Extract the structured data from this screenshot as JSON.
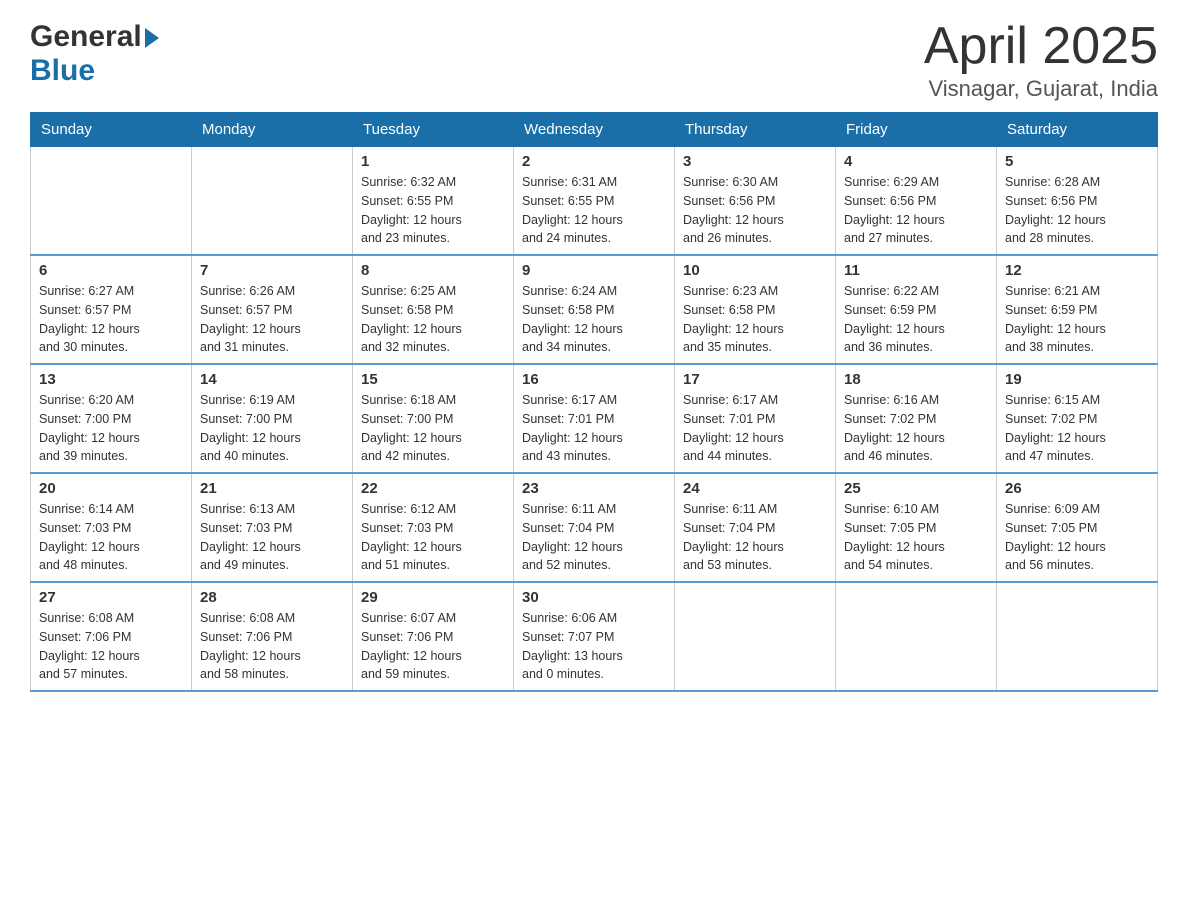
{
  "header": {
    "logo_general": "General",
    "logo_blue": "Blue",
    "title": "April 2025",
    "location": "Visnagar, Gujarat, India"
  },
  "weekdays": [
    "Sunday",
    "Monday",
    "Tuesday",
    "Wednesday",
    "Thursday",
    "Friday",
    "Saturday"
  ],
  "weeks": [
    [
      {
        "day": "",
        "info": ""
      },
      {
        "day": "",
        "info": ""
      },
      {
        "day": "1",
        "info": "Sunrise: 6:32 AM\nSunset: 6:55 PM\nDaylight: 12 hours\nand 23 minutes."
      },
      {
        "day": "2",
        "info": "Sunrise: 6:31 AM\nSunset: 6:55 PM\nDaylight: 12 hours\nand 24 minutes."
      },
      {
        "day": "3",
        "info": "Sunrise: 6:30 AM\nSunset: 6:56 PM\nDaylight: 12 hours\nand 26 minutes."
      },
      {
        "day": "4",
        "info": "Sunrise: 6:29 AM\nSunset: 6:56 PM\nDaylight: 12 hours\nand 27 minutes."
      },
      {
        "day": "5",
        "info": "Sunrise: 6:28 AM\nSunset: 6:56 PM\nDaylight: 12 hours\nand 28 minutes."
      }
    ],
    [
      {
        "day": "6",
        "info": "Sunrise: 6:27 AM\nSunset: 6:57 PM\nDaylight: 12 hours\nand 30 minutes."
      },
      {
        "day": "7",
        "info": "Sunrise: 6:26 AM\nSunset: 6:57 PM\nDaylight: 12 hours\nand 31 minutes."
      },
      {
        "day": "8",
        "info": "Sunrise: 6:25 AM\nSunset: 6:58 PM\nDaylight: 12 hours\nand 32 minutes."
      },
      {
        "day": "9",
        "info": "Sunrise: 6:24 AM\nSunset: 6:58 PM\nDaylight: 12 hours\nand 34 minutes."
      },
      {
        "day": "10",
        "info": "Sunrise: 6:23 AM\nSunset: 6:58 PM\nDaylight: 12 hours\nand 35 minutes."
      },
      {
        "day": "11",
        "info": "Sunrise: 6:22 AM\nSunset: 6:59 PM\nDaylight: 12 hours\nand 36 minutes."
      },
      {
        "day": "12",
        "info": "Sunrise: 6:21 AM\nSunset: 6:59 PM\nDaylight: 12 hours\nand 38 minutes."
      }
    ],
    [
      {
        "day": "13",
        "info": "Sunrise: 6:20 AM\nSunset: 7:00 PM\nDaylight: 12 hours\nand 39 minutes."
      },
      {
        "day": "14",
        "info": "Sunrise: 6:19 AM\nSunset: 7:00 PM\nDaylight: 12 hours\nand 40 minutes."
      },
      {
        "day": "15",
        "info": "Sunrise: 6:18 AM\nSunset: 7:00 PM\nDaylight: 12 hours\nand 42 minutes."
      },
      {
        "day": "16",
        "info": "Sunrise: 6:17 AM\nSunset: 7:01 PM\nDaylight: 12 hours\nand 43 minutes."
      },
      {
        "day": "17",
        "info": "Sunrise: 6:17 AM\nSunset: 7:01 PM\nDaylight: 12 hours\nand 44 minutes."
      },
      {
        "day": "18",
        "info": "Sunrise: 6:16 AM\nSunset: 7:02 PM\nDaylight: 12 hours\nand 46 minutes."
      },
      {
        "day": "19",
        "info": "Sunrise: 6:15 AM\nSunset: 7:02 PM\nDaylight: 12 hours\nand 47 minutes."
      }
    ],
    [
      {
        "day": "20",
        "info": "Sunrise: 6:14 AM\nSunset: 7:03 PM\nDaylight: 12 hours\nand 48 minutes."
      },
      {
        "day": "21",
        "info": "Sunrise: 6:13 AM\nSunset: 7:03 PM\nDaylight: 12 hours\nand 49 minutes."
      },
      {
        "day": "22",
        "info": "Sunrise: 6:12 AM\nSunset: 7:03 PM\nDaylight: 12 hours\nand 51 minutes."
      },
      {
        "day": "23",
        "info": "Sunrise: 6:11 AM\nSunset: 7:04 PM\nDaylight: 12 hours\nand 52 minutes."
      },
      {
        "day": "24",
        "info": "Sunrise: 6:11 AM\nSunset: 7:04 PM\nDaylight: 12 hours\nand 53 minutes."
      },
      {
        "day": "25",
        "info": "Sunrise: 6:10 AM\nSunset: 7:05 PM\nDaylight: 12 hours\nand 54 minutes."
      },
      {
        "day": "26",
        "info": "Sunrise: 6:09 AM\nSunset: 7:05 PM\nDaylight: 12 hours\nand 56 minutes."
      }
    ],
    [
      {
        "day": "27",
        "info": "Sunrise: 6:08 AM\nSunset: 7:06 PM\nDaylight: 12 hours\nand 57 minutes."
      },
      {
        "day": "28",
        "info": "Sunrise: 6:08 AM\nSunset: 7:06 PM\nDaylight: 12 hours\nand 58 minutes."
      },
      {
        "day": "29",
        "info": "Sunrise: 6:07 AM\nSunset: 7:06 PM\nDaylight: 12 hours\nand 59 minutes."
      },
      {
        "day": "30",
        "info": "Sunrise: 6:06 AM\nSunset: 7:07 PM\nDaylight: 13 hours\nand 0 minutes."
      },
      {
        "day": "",
        "info": ""
      },
      {
        "day": "",
        "info": ""
      },
      {
        "day": "",
        "info": ""
      }
    ]
  ]
}
